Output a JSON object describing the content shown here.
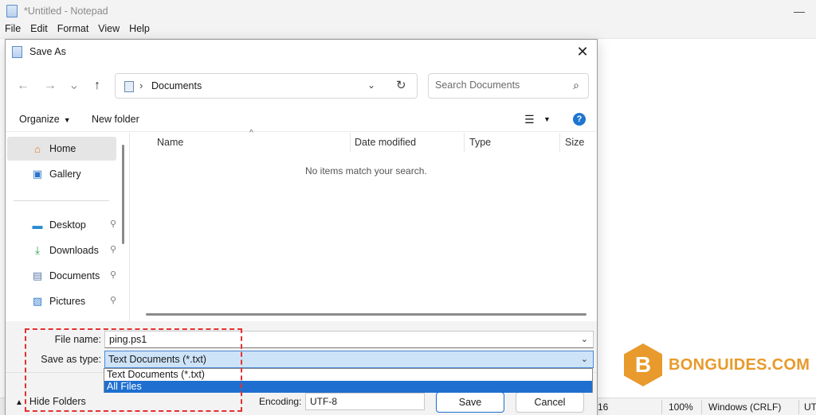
{
  "notepad": {
    "title": "*Untitled - Notepad",
    "minimize_glyph": "—",
    "menu": [
      "File",
      "Edit",
      "Format",
      "View",
      "Help"
    ],
    "status": {
      "position": "16",
      "zoom": "100%",
      "line_ending": "Windows (CRLF)",
      "encoding": "UT"
    }
  },
  "watermark": {
    "letter": "B",
    "text": "BONGUIDES.COM",
    "color": "#e89a2c"
  },
  "dialog": {
    "title": "Save As",
    "close_glyph": "✕",
    "nav": {
      "back": "←",
      "forward": "→",
      "recent": "⌄",
      "up": "↑"
    },
    "address": {
      "separator": "›",
      "crumb": "Documents",
      "dropdown": "⌄",
      "refresh": "↻"
    },
    "search": {
      "placeholder": "Search Documents",
      "icon": "⌕"
    },
    "toolbar": {
      "organize": "Organize",
      "new_folder": "New folder",
      "view_glyph": "☰",
      "help_glyph": "?"
    },
    "sidebar": {
      "items": [
        {
          "label": "Home",
          "icon": "home-icon",
          "glyph": "⌂"
        },
        {
          "label": "Gallery",
          "icon": "gallery-icon",
          "glyph": "▣"
        },
        {
          "label": "Desktop",
          "icon": "desktop-icon",
          "glyph": "▬"
        },
        {
          "label": "Downloads",
          "icon": "downloads-icon",
          "glyph": "⤓"
        },
        {
          "label": "Documents",
          "icon": "documents-icon",
          "glyph": "▤"
        },
        {
          "label": "Pictures",
          "icon": "pictures-icon",
          "glyph": "▨"
        }
      ],
      "pin_glyph": "📌"
    },
    "file_list": {
      "sort_glyph": "^",
      "columns": [
        "Name",
        "Date modified",
        "Type",
        "Size"
      ],
      "empty_message": "No items match your search."
    },
    "form": {
      "file_name_label": "File name:",
      "file_name_value": "ping.ps1",
      "save_type_label": "Save as type:",
      "save_type_value": "Text Documents (*.txt)",
      "type_options": [
        "Text Documents (*.txt)",
        "All Files"
      ],
      "selected_option": "All Files"
    },
    "footer": {
      "hide_folders": "Hide Folders",
      "encoding_label": "Encoding:",
      "encoding_value": "UTF-8",
      "save": "Save",
      "cancel": "Cancel"
    }
  },
  "colors": {
    "accent": "#1e6fd0",
    "highlight_box": "#e53030"
  }
}
